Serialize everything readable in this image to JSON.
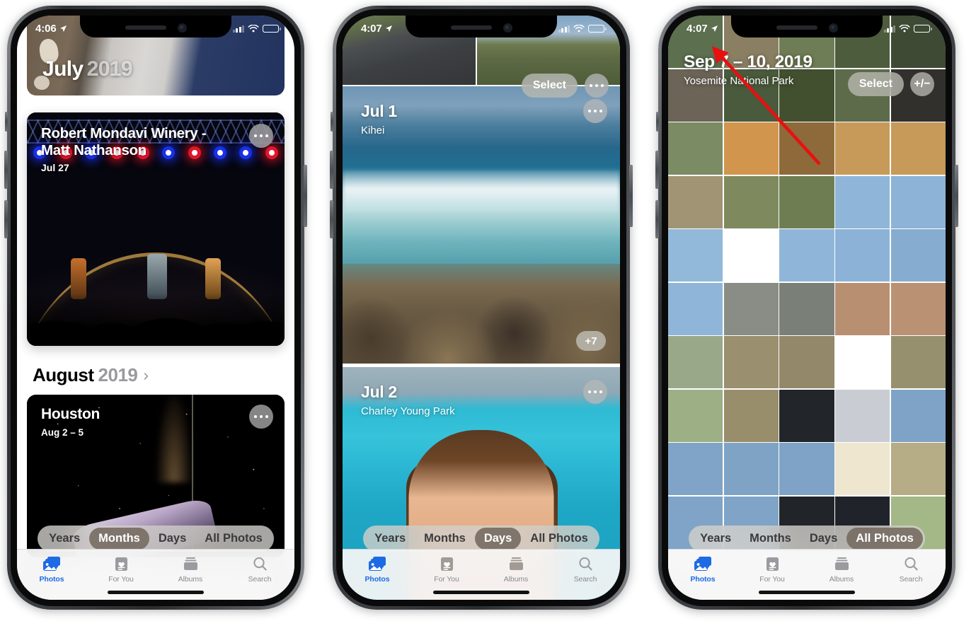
{
  "phones": [
    {
      "id": "months",
      "status": {
        "time": "4:06",
        "location_icon": "location-arrow-icon",
        "signal": "cellular-bars-icon",
        "wifi": "wifi-icon",
        "battery": "battery-icon"
      },
      "hero": {
        "month": "July",
        "year": "2019"
      },
      "cards": [
        {
          "title": "Robert Mondavi Winery - Matt Nathanson",
          "subtitle": "Jul 27",
          "menu": "ellipsis-icon"
        },
        {
          "title": "Houston",
          "subtitle": "Aug 2 – 5",
          "menu": "ellipsis-icon"
        }
      ],
      "month_header": {
        "month": "August",
        "year": "2019",
        "chevron": "chevron-right-icon"
      },
      "segment": {
        "items": [
          "Years",
          "Months",
          "Days",
          "All Photos"
        ],
        "active": "Months"
      },
      "tabs": [
        {
          "label": "Photos",
          "icon": "photos-icon",
          "active": true
        },
        {
          "label": "For You",
          "icon": "for-you-icon",
          "active": false
        },
        {
          "label": "Albums",
          "icon": "albums-icon",
          "active": false
        },
        {
          "label": "Search",
          "icon": "search-icon",
          "active": false
        }
      ]
    },
    {
      "id": "days",
      "status": {
        "time": "4:07",
        "location_icon": "location-arrow-icon",
        "signal": "cellular-bars-icon",
        "wifi": "wifi-icon",
        "battery": "battery-icon"
      },
      "toolbar": {
        "select_label": "Select",
        "menu": "ellipsis-icon"
      },
      "days": [
        {
          "title": "Jul 1",
          "subtitle": "Kihei",
          "menu": "ellipsis-icon",
          "more_count": "+7"
        },
        {
          "title": "Jul 2",
          "subtitle": "Charley Young Park",
          "menu": "ellipsis-icon"
        }
      ],
      "segment": {
        "items": [
          "Years",
          "Months",
          "Days",
          "All Photos"
        ],
        "active": "Days"
      },
      "tabs": [
        {
          "label": "Photos",
          "icon": "photos-icon",
          "active": true
        },
        {
          "label": "For You",
          "icon": "for-you-icon",
          "active": false
        },
        {
          "label": "Albums",
          "icon": "albums-icon",
          "active": false
        },
        {
          "label": "Search",
          "icon": "search-icon",
          "active": false
        }
      ]
    },
    {
      "id": "all-photos",
      "status": {
        "time": "4:07",
        "location_icon": "location-arrow-icon",
        "signal": "cellular-bars-icon",
        "wifi": "wifi-icon",
        "battery": "battery-icon"
      },
      "header": {
        "title": "Sep 7 – 10, 2019",
        "subtitle": "Yosemite National Park"
      },
      "toolbar": {
        "select_label": "Select",
        "zoom_label": "+/−"
      },
      "annotation": {
        "type": "red-arrow",
        "color": "#e81010",
        "points_to": "zoom-level-button"
      },
      "segment": {
        "items": [
          "Years",
          "Months",
          "Days",
          "All Photos"
        ],
        "active": "All Photos"
      },
      "tabs": [
        {
          "label": "Photos",
          "icon": "photos-icon",
          "active": true
        },
        {
          "label": "For You",
          "icon": "for-you-icon",
          "active": false
        },
        {
          "label": "Albums",
          "icon": "albums-icon",
          "active": false
        },
        {
          "label": "Search",
          "icon": "search-icon",
          "active": false
        }
      ],
      "grid": {
        "columns": 5,
        "cells": [
          "#5c6f4e",
          "#8a7f63",
          "#6f7d56",
          "#4e5c3e",
          "#3e4a34",
          "#6b6457",
          "#4a5a3c",
          "#43502f",
          "#5d6b4a",
          "#31302c",
          "#7b8b63",
          "#d2954e",
          "#8e6a3a",
          "#c79a5a",
          "#c79a5a",
          "#a09474",
          "#7e8a5e",
          "#6f7e52",
          "#8fb6d8",
          "#8db3d6",
          "#93b9da",
          "#ffffff",
          "#8fb6d8",
          "#8cb3d7",
          "#86add0",
          "#8fb6d8",
          "#8a8d86",
          "#7a7f78",
          "#b98f72",
          "#bb9174",
          "#9aa88a",
          "#9a8f6e",
          "#93886a",
          "#ffffff",
          "#97906e",
          "#9daf84",
          "#998e6c",
          "#22262b",
          "#c9cdd3",
          "#7ea3c6",
          "#7fa4c7",
          "#7fa3c5",
          "#7fa3c6",
          "#efe6cf",
          "#b6ad86",
          "#7fa4c7",
          "#7fa4c7",
          "#21252a",
          "#20242a",
          "#a4b787"
        ]
      }
    }
  ]
}
